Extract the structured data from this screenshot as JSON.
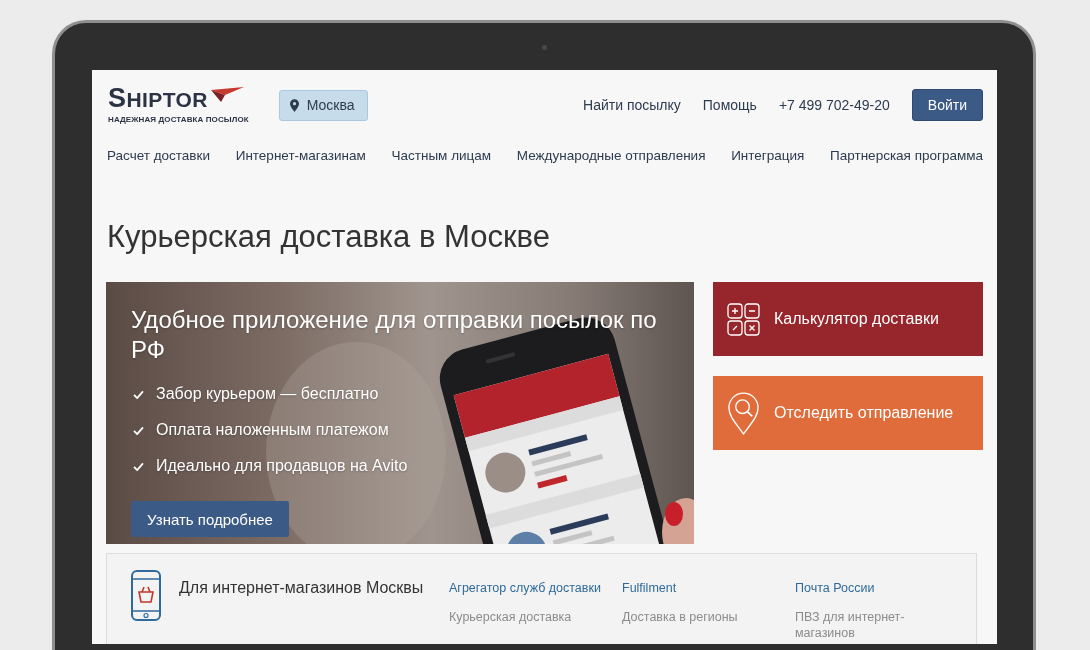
{
  "header": {
    "logo": {
      "wordmark": "SHIPTOR",
      "tagline": "НАДЕЖНАЯ ДОСТАВКА ПОСЫЛОК"
    },
    "city_button": "Москва",
    "links": [
      "Найти посылку",
      "Помощь"
    ],
    "phone": "+7 499 702-49-20",
    "login_button": "Войти"
  },
  "nav": [
    "Расчет доставки",
    "Интернет-магазинам",
    "Частным лицам",
    "Международные отправления",
    "Интеграция",
    "Партнерская программа"
  ],
  "page_title": "Курьерская доставка в Москве",
  "banner": {
    "title": "Удобное приложение для отправки посылок по РФ",
    "features": [
      "Забор курьером — бесплатно",
      "Оплата наложенным платежом",
      "Идеально для продавцов на Avito"
    ],
    "button": "Узнать подробнее"
  },
  "action_cards": [
    {
      "kind": "calculator",
      "label": "Калькулятор доставки",
      "color": "#96262b"
    },
    {
      "kind": "tracking",
      "label": "Отследить отправление",
      "color": "#e06c3b"
    }
  ],
  "services": {
    "title": "Для интернет-магазинов Москвы",
    "columns": [
      {
        "heading": "Агрегатор служб доставки",
        "link": "Курьерская доставка"
      },
      {
        "heading": "Fulfilment",
        "link": "Доставка в регионы"
      },
      {
        "heading": "Почта России",
        "link": "ПВЗ для интернет-магазинов"
      }
    ]
  }
}
